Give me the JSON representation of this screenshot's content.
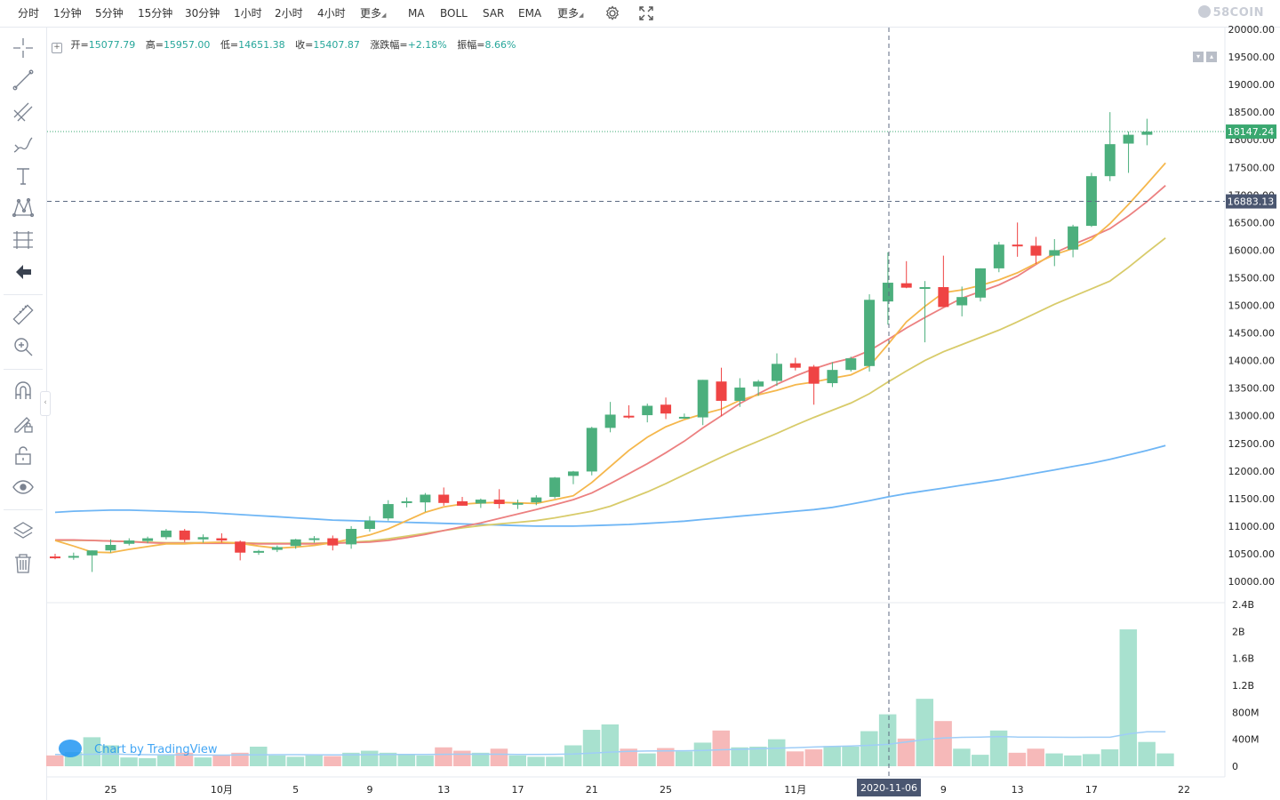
{
  "toolbar": {
    "intervals": [
      "分时",
      "1分钟",
      "5分钟",
      "15分钟",
      "30分钟",
      "1小时",
      "2小时",
      "4小时",
      "更多"
    ],
    "indicators": [
      "MA",
      "BOLL",
      "SAR",
      "EMA",
      "更多"
    ],
    "logo": "58COIN"
  },
  "legend": {
    "open_label": "开=",
    "open": "15077.79",
    "high_label": "高=",
    "high": "15957.00",
    "low_label": "低=",
    "low": "14651.38",
    "close_label": "收=",
    "close": "15407.87",
    "change_label": "涨跌幅=",
    "change": "+2.18%",
    "amplitude_label": "振幅=",
    "amplitude": "8.66%"
  },
  "watermark": "Chart by TradingView",
  "colors": {
    "up": "#4caf7d",
    "down": "#ef4444",
    "vol_up": "#a8e1cf",
    "vol_down": "#f6b9b9",
    "ma_orange": "#f5b74c",
    "ma_red": "#ec8080",
    "ma_yellow": "#d8cb6a",
    "ma_blue": "#6fb6f5",
    "last_price": "#3aa870",
    "crosshair": "#5c6a82"
  },
  "chart_data": {
    "type": "candlestick",
    "x_ticks": [
      {
        "label": "25",
        "i": 3
      },
      {
        "label": "10月",
        "i": 9
      },
      {
        "label": "5",
        "i": 13
      },
      {
        "label": "9",
        "i": 17
      },
      {
        "label": "13",
        "i": 21
      },
      {
        "label": "17",
        "i": 25
      },
      {
        "label": "21",
        "i": 29
      },
      {
        "label": "25",
        "i": 33
      },
      {
        "label": "11月",
        "i": 40
      },
      {
        "label": "9",
        "i": 48
      },
      {
        "label": "13",
        "i": 52
      },
      {
        "label": "17",
        "i": 56
      },
      {
        "label": "22",
        "i": 61
      }
    ],
    "price_ticks": [
      "20000.00",
      "19500.00",
      "19000.00",
      "18500.00",
      "18000.00",
      "17500.00",
      "17000.00",
      "16500.00",
      "16000.00",
      "15500.00",
      "15000.00",
      "14500.00",
      "14000.00",
      "13500.00",
      "13000.00",
      "12500.00",
      "12000.00",
      "11500.00",
      "11000.00",
      "10500.00",
      "10000.00"
    ],
    "price_range": [
      9800,
      20000
    ],
    "volume_ticks": [
      "2.4B",
      "2B",
      "1.6B",
      "1.2B",
      "800M",
      "400M",
      "0"
    ],
    "volume_range": [
      0,
      2400
    ],
    "candles": [
      [
        10450,
        10500,
        10400,
        10430
      ],
      [
        10440,
        10520,
        10390,
        10460
      ],
      [
        10470,
        10560,
        10170,
        10560
      ],
      [
        10560,
        10760,
        10520,
        10660
      ],
      [
        10680,
        10780,
        10650,
        10740
      ],
      [
        10730,
        10810,
        10690,
        10780
      ],
      [
        10800,
        10950,
        10760,
        10920
      ],
      [
        10920,
        10950,
        10710,
        10750
      ],
      [
        10760,
        10850,
        10700,
        10800
      ],
      [
        10780,
        10870,
        10700,
        10740
      ],
      [
        10720,
        10740,
        10380,
        10520
      ],
      [
        10520,
        10570,
        10480,
        10550
      ],
      [
        10570,
        10650,
        10530,
        10620
      ],
      [
        10640,
        10770,
        10590,
        10760
      ],
      [
        10750,
        10820,
        10700,
        10780
      ],
      [
        10780,
        10830,
        10560,
        10650
      ],
      [
        10670,
        11000,
        10590,
        10950
      ],
      [
        10950,
        11180,
        10900,
        11100
      ],
      [
        11140,
        11470,
        11100,
        11400
      ],
      [
        11420,
        11520,
        11340,
        11450
      ],
      [
        11430,
        11600,
        11260,
        11570
      ],
      [
        11570,
        11700,
        11370,
        11420
      ],
      [
        11450,
        11530,
        11370,
        11370
      ],
      [
        11410,
        11500,
        11330,
        11480
      ],
      [
        11480,
        11670,
        11320,
        11400
      ],
      [
        11390,
        11480,
        11310,
        11420
      ],
      [
        11430,
        11560,
        11380,
        11520
      ],
      [
        11530,
        11890,
        11500,
        11880
      ],
      [
        11910,
        12000,
        11760,
        11990
      ],
      [
        11990,
        12800,
        11920,
        12780
      ],
      [
        12780,
        13250,
        12700,
        13020
      ],
      [
        13000,
        13190,
        12950,
        12990
      ],
      [
        13010,
        13220,
        12880,
        13180
      ],
      [
        13200,
        13330,
        12940,
        13040
      ],
      [
        12980,
        13040,
        12950,
        12980
      ],
      [
        12970,
        13650,
        12830,
        13650
      ],
      [
        13620,
        13870,
        12990,
        13270
      ],
      [
        13270,
        13680,
        13160,
        13510
      ],
      [
        13530,
        13650,
        13360,
        13620
      ],
      [
        13630,
        14130,
        13540,
        13940
      ],
      [
        13950,
        14050,
        13820,
        13870
      ],
      [
        13890,
        13920,
        13200,
        13580
      ],
      [
        13590,
        13970,
        13520,
        13830
      ],
      [
        13830,
        14070,
        13800,
        14040
      ],
      [
        13900,
        15200,
        13800,
        15100
      ],
      [
        15070,
        15960,
        14650,
        15410
      ],
      [
        15400,
        15800,
        15310,
        15320
      ],
      [
        15320,
        15440,
        14330,
        15330
      ],
      [
        15330,
        15900,
        15170,
        14970
      ],
      [
        15000,
        15340,
        14800,
        15150
      ],
      [
        15140,
        15670,
        15070,
        15670
      ],
      [
        15670,
        16150,
        15600,
        16100
      ],
      [
        16100,
        16500,
        15880,
        16080
      ],
      [
        16080,
        16240,
        15750,
        15900
      ],
      [
        15900,
        16200,
        15710,
        16000
      ],
      [
        16010,
        16460,
        15870,
        16430
      ],
      [
        16440,
        17400,
        16420,
        17340
      ],
      [
        17340,
        18500,
        17250,
        17920
      ],
      [
        17930,
        18150,
        17400,
        18090
      ],
      [
        18090,
        18380,
        17900,
        18147
      ]
    ],
    "volumes": [
      160,
      210,
      430,
      310,
      130,
      120,
      160,
      200,
      130,
      160,
      200,
      290,
      160,
      140,
      160,
      150,
      200,
      230,
      200,
      170,
      160,
      280,
      230,
      200,
      260,
      160,
      140,
      140,
      310,
      540,
      620,
      260,
      190,
      270,
      220,
      350,
      530,
      280,
      290,
      400,
      220,
      250,
      300,
      290,
      520,
      770,
      410,
      1000,
      670,
      260,
      170,
      530,
      200,
      260,
      190,
      160,
      180,
      250,
      2030,
      360,
      190
    ],
    "volume_ma": [
      175,
      172,
      178,
      182,
      176,
      172,
      170,
      168,
      166,
      165,
      167,
      170,
      172,
      171,
      170,
      168,
      170,
      172,
      174,
      176,
      175,
      177,
      178,
      178,
      178,
      176,
      175,
      177,
      182,
      195,
      210,
      220,
      225,
      228,
      230,
      234,
      244,
      250,
      260,
      268,
      275,
      285,
      293,
      300,
      310,
      325,
      360,
      395,
      418,
      428,
      432,
      440,
      433,
      432,
      430,
      428,
      430,
      430,
      480,
      510,
      510
    ],
    "ma_orange": [
      10740,
      10640,
      10530,
      10520,
      10580,
      10630,
      10680,
      10680,
      10700,
      10710,
      10690,
      10640,
      10600,
      10620,
      10650,
      10700,
      10770,
      10840,
      10950,
      11100,
      11250,
      11350,
      11400,
      11420,
      11430,
      11420,
      11410,
      11480,
      11550,
      11790,
      12080,
      12370,
      12610,
      12800,
      12930,
      13030,
      13120,
      13280,
      13380,
      13460,
      13560,
      13610,
      13680,
      13740,
      13900,
      14290,
      14700,
      14980,
      15230,
      15280,
      15360,
      15460,
      15590,
      15760,
      15920,
      16030,
      16190,
      16480,
      16830,
      17200,
      17580
    ],
    "ma_red": [
      10750,
      10750,
      10740,
      10730,
      10720,
      10700,
      10690,
      10690,
      10690,
      10690,
      10690,
      10680,
      10680,
      10680,
      10680,
      10690,
      10700,
      10710,
      10740,
      10790,
      10850,
      10920,
      10990,
      11060,
      11140,
      11220,
      11300,
      11390,
      11480,
      11600,
      11770,
      11950,
      12130,
      12330,
      12540,
      12780,
      13000,
      13220,
      13400,
      13570,
      13720,
      13850,
      13960,
      14040,
      14180,
      14380,
      14590,
      14780,
      14960,
      15130,
      15250,
      15370,
      15530,
      15740,
      15950,
      16100,
      16240,
      16390,
      16620,
      16880,
      17170
    ],
    "ma_yellow": [
      10740,
      10740,
      10740,
      10730,
      10720,
      10710,
      10700,
      10700,
      10700,
      10700,
      10700,
      10690,
      10690,
      10690,
      10690,
      10700,
      10710,
      10730,
      10770,
      10820,
      10870,
      10920,
      10970,
      11010,
      11040,
      11070,
      11100,
      11150,
      11210,
      11270,
      11360,
      11490,
      11620,
      11770,
      11930,
      12090,
      12250,
      12400,
      12540,
      12680,
      12830,
      12970,
      13100,
      13230,
      13400,
      13610,
      13810,
      14000,
      14160,
      14290,
      14420,
      14550,
      14700,
      14860,
      15020,
      15160,
      15300,
      15440,
      15690,
      15960,
      16220
    ],
    "ma_blue": [
      11250,
      11270,
      11280,
      11290,
      11290,
      11280,
      11270,
      11260,
      11250,
      11230,
      11210,
      11190,
      11170,
      11150,
      11130,
      11110,
      11100,
      11090,
      11080,
      11070,
      11060,
      11050,
      11040,
      11030,
      11020,
      11010,
      11000,
      11000,
      11000,
      11010,
      11020,
      11030,
      11050,
      11070,
      11090,
      11120,
      11150,
      11180,
      11210,
      11240,
      11270,
      11300,
      11340,
      11400,
      11460,
      11530,
      11590,
      11640,
      11690,
      11740,
      11790,
      11840,
      11900,
      11960,
      12020,
      12080,
      12140,
      12210,
      12290,
      12370,
      12460
    ]
  },
  "price_labels": {
    "last_price": "18147.24",
    "crosshair_price": "16883.13",
    "crosshair_time": "2020-11-06"
  }
}
